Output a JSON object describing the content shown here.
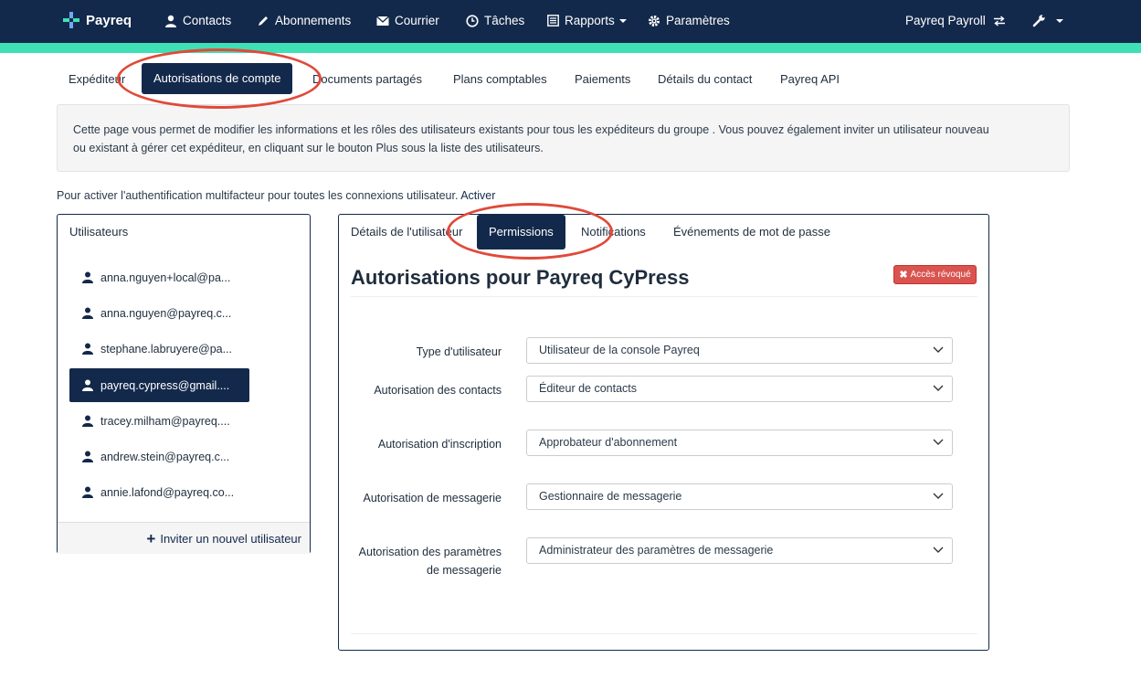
{
  "navbar": {
    "brand": "Payreq",
    "items": [
      "Contacts",
      "Abonnements",
      "Courrier",
      "Tâches",
      "Rapports",
      "Paramètres"
    ],
    "account": "Payreq Payroll"
  },
  "subtabs": [
    "Expéditeur",
    "Autorisations de compte",
    "Documents partagés",
    "Plans comptables",
    "Paiements",
    "Détails du contact",
    "Payreq API"
  ],
  "info": {
    "line1": "Cette page vous permet de modifier les informations et les rôles des utilisateurs existants pour tous les expéditeurs du groupe . Vous pouvez également inviter un utilisateur nouveau",
    "line2": "ou existant à gérer cet expéditeur, en cliquant sur le bouton Plus sous la liste des utilisateurs."
  },
  "mfa": {
    "text": "Pour activer l'authentification multifacteur pour toutes les connexions utilisateur. ",
    "link": "Activer"
  },
  "users": {
    "title": "Utilisateurs",
    "list": [
      "anna.nguyen+local@pa...",
      "anna.nguyen@payreq.c...",
      "stephane.labruyere@pa...",
      "payreq.cypress@gmail....",
      "tracey.milham@payreq....",
      "andrew.stein@payreq.c...",
      "annie.lafond@payreq.co..."
    ],
    "invite": "Inviter un nouvel utilisateur"
  },
  "perm": {
    "tabs": [
      "Détails de l'utilisateur",
      "Permissions",
      "Notifications",
      "Événements de mot de passe"
    ],
    "title": "Autorisations pour Payreq CyPress",
    "revoke": "Accès révoqué",
    "fields": [
      {
        "label": "Type d'utilisateur",
        "value": "Utilisateur de la console Payreq"
      },
      {
        "label": "Autorisation des contacts",
        "value": "Éditeur de contacts"
      },
      {
        "label": "Autorisation d'inscription",
        "value": "Approbateur d'abonnement"
      },
      {
        "label": "Autorisation de messagerie",
        "value": "Gestionnaire de messagerie"
      },
      {
        "label": "Autorisation des paramètres de messagerie",
        "value": "Administrateur des paramètres de messagerie"
      }
    ]
  },
  "colors": {
    "navy": "#13294b",
    "accent": "#3fe0b5",
    "danger": "#d9534f",
    "annotation": "#e04a3a"
  }
}
